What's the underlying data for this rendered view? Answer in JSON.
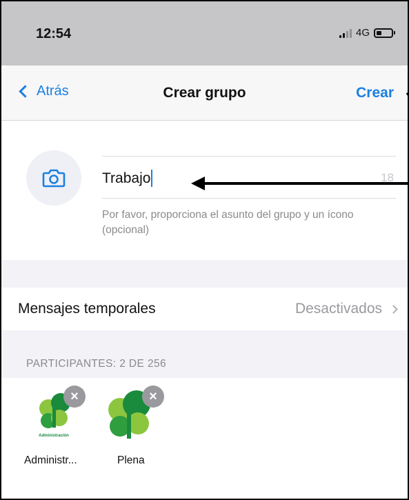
{
  "status_bar": {
    "time": "12:54",
    "network": "4G",
    "icons": [
      "signal-icon",
      "battery-icon"
    ]
  },
  "nav": {
    "back_label": "Atrás",
    "title": "Crear grupo",
    "create_label": "Crear",
    "back_icon": "chevron-left-icon"
  },
  "group": {
    "camera_icon": "camera-icon",
    "name_value": "Trabajo",
    "remaining_chars": "18",
    "hint": "Por favor, proporciona el asunto del grupo y un ícono (opcional)"
  },
  "disappearing": {
    "label": "Mensajes temporales",
    "value": "Desactivados",
    "icon": "chevron-right-icon"
  },
  "participants": {
    "header": "PARTICIPANTES: 2 DE 256",
    "items": [
      {
        "name": "Administr...",
        "logo_text": "Administración"
      },
      {
        "name": "Plena"
      }
    ],
    "remove_icon": "close-icon"
  },
  "colors": {
    "accent": "#1a7fe2",
    "clover_light": "#8cc63f",
    "clover_dark": "#1a8a3c"
  }
}
